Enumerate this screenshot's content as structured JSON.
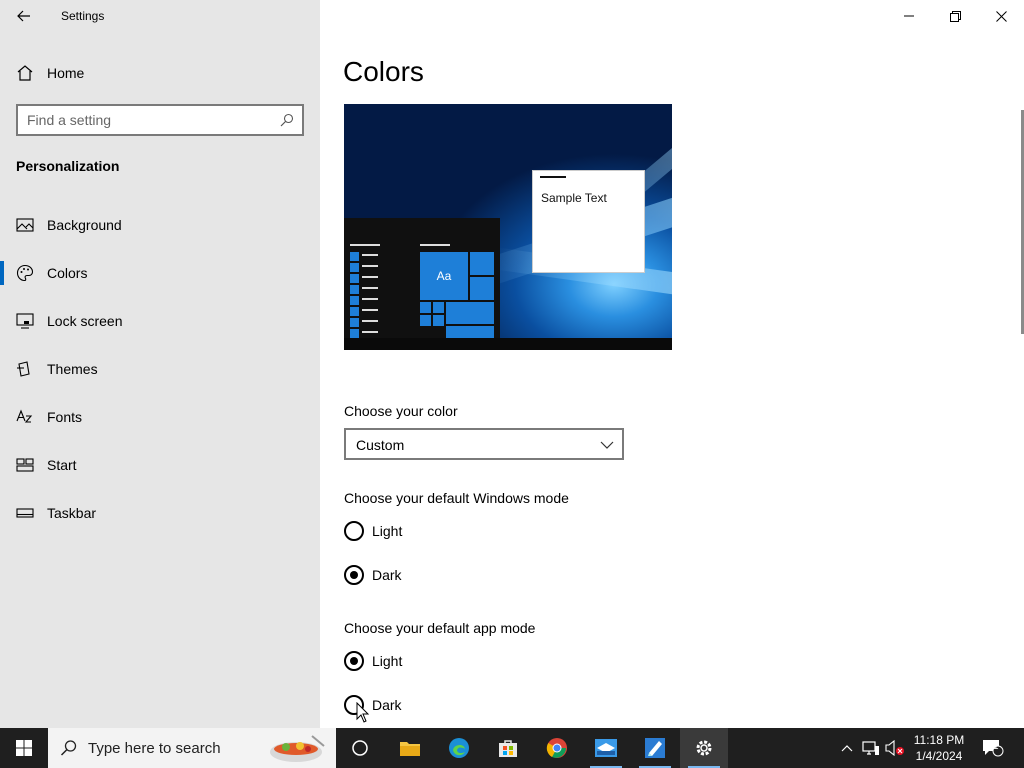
{
  "app": {
    "title": "Settings"
  },
  "sidebar": {
    "home_label": "Home",
    "search_placeholder": "Find a setting",
    "section_title": "Personalization",
    "items": [
      {
        "label": "Background",
        "icon": "image-icon"
      },
      {
        "label": "Colors",
        "icon": "palette-icon",
        "active": true
      },
      {
        "label": "Lock screen",
        "icon": "lock-screen-icon"
      },
      {
        "label": "Themes",
        "icon": "themes-icon"
      },
      {
        "label": "Fonts",
        "icon": "fonts-icon"
      },
      {
        "label": "Start",
        "icon": "start-icon"
      },
      {
        "label": "Taskbar",
        "icon": "taskbar-icon"
      }
    ]
  },
  "main": {
    "title": "Colors",
    "preview": {
      "sample_text": "Sample Text",
      "tile_text": "Aa"
    },
    "choose_color": {
      "label": "Choose your color",
      "value": "Custom"
    },
    "windows_mode": {
      "label": "Choose your default Windows mode",
      "options": [
        {
          "label": "Light",
          "checked": false
        },
        {
          "label": "Dark",
          "checked": true
        }
      ]
    },
    "app_mode": {
      "label": "Choose your default app mode",
      "options": [
        {
          "label": "Light",
          "checked": true
        },
        {
          "label": "Dark",
          "checked": false
        }
      ]
    }
  },
  "taskbar": {
    "search_placeholder": "Type here to search",
    "time": "11:18 PM",
    "date": "1/4/2024",
    "notification_count": "1"
  },
  "colors": {
    "accent": "#0067c0",
    "tile_blue": "#1e7fd8",
    "taskbar": "#1f1f1f",
    "sidebar": "#e6e6e6"
  }
}
